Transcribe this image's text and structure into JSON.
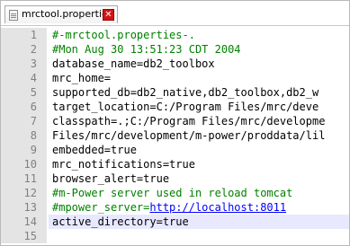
{
  "tab": {
    "label": "mrctool.properties",
    "close_glyph": "✕"
  },
  "colors": {
    "comment": "#008000",
    "url": "#0000ff",
    "gutter": "#e4e4e4",
    "current_line": "#e8e8ff"
  },
  "editor": {
    "current_line": 13,
    "lines": [
      {
        "n": "1",
        "text": "#-mrctool.properties-.",
        "type": "comment"
      },
      {
        "n": "2",
        "text": "#Mon Aug 30 13:51:23 CDT 2004",
        "type": "comment"
      },
      {
        "n": "3",
        "text": "database_name=db2_toolbox",
        "type": "text"
      },
      {
        "n": "4",
        "text": "mrc_home=",
        "type": "text"
      },
      {
        "n": "5",
        "text": "supported_db=db2_native,db2_toolbox,db2_w",
        "type": "text"
      },
      {
        "n": "6",
        "text": "target_location=C:/Program Files/mrc/deve",
        "type": "text"
      },
      {
        "n": "7",
        "text": "classpath=.;C:/Program Files/mrc/developme",
        "type": "text"
      },
      {
        "n": "8",
        "text": "Files/mrc/development/m-power/proddata/lil",
        "type": "text"
      },
      {
        "n": "9",
        "text": "embedded=true",
        "type": "text"
      },
      {
        "n": "10",
        "text": "mrc_notifications=true",
        "type": "text"
      },
      {
        "n": "11",
        "text": "browser_alert=true",
        "type": "text"
      },
      {
        "n": "12",
        "text": "#m-Power server used in reload tomcat",
        "type": "comment"
      },
      {
        "n": "13",
        "text_prefix": "#mpower_server=",
        "url": "http://localhost:8011",
        "type": "comment-url"
      },
      {
        "n": "14",
        "text": "active_directory=true",
        "type": "text"
      },
      {
        "n": "15",
        "text": "",
        "type": "text"
      }
    ]
  }
}
